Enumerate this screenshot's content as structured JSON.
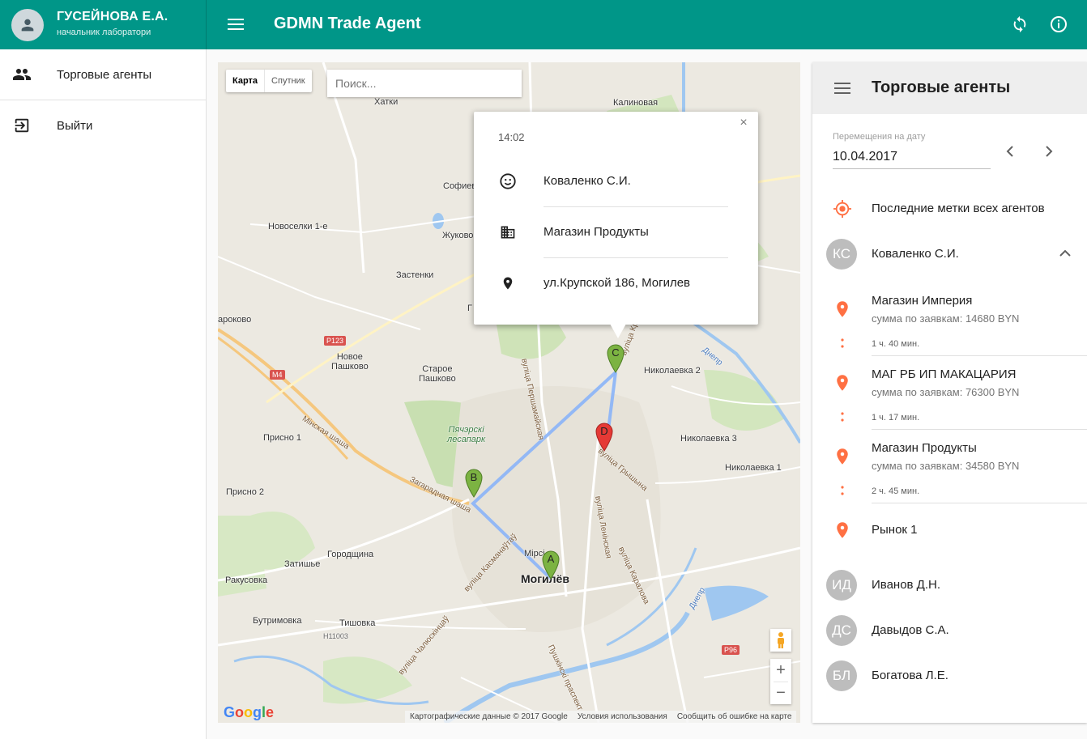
{
  "user": {
    "name": "ГУСЕЙНОВА Е.А.",
    "role": "начальник лаборатори"
  },
  "app": {
    "title": "GDMN Trade Agent"
  },
  "nav": [
    {
      "label": "Торговые агенты",
      "icon": "people-icon"
    },
    {
      "label": "Выйти",
      "icon": "exit-icon"
    }
  ],
  "map": {
    "type_options": [
      "Карта",
      "Спутник"
    ],
    "type_selected": "Карта",
    "search_placeholder": "Поиск...",
    "labels": {
      "hatki": "Хатки",
      "kalinovaya": "Калиновая",
      "sofievka": "Софиев",
      "novoselki": "Новоселки 1-е",
      "zhukovo": "Жуково",
      "zastenki": "Застенки",
      "g": "Г",
      "prokovo": "ароково",
      "novoe_pashkovo": "Новое\nПашково",
      "staroe_pashkovo": "Старое\nПашково",
      "nikolaevka2": "Николаевка 2",
      "nikolaevka3": "Николаевка 3",
      "nikolaevka1": "Николаевка 1",
      "prisno1": "Присно 1",
      "prisno2": "Присно 2",
      "park": "Пячэрскі\nлесапарк",
      "minsk_road": "Мінская шаша",
      "zagorad_road": "Загарадная шаша",
      "zatishe": "Затишье",
      "gorodshchina": "Городщина",
      "rakusovka": "Ракусовка",
      "butrimovka": "Бутримовка",
      "tishovka": "Тишовка",
      "mogilev": "Могилёв",
      "mir": "Мірсі",
      "dnepr1": "Днепр",
      "dnepr2": "Днепр",
      "perashkovskaya": "вуліца Першамайская",
      "kruplskaya": "вуліца Крупскай",
      "gryshyna": "вуліца Грышына",
      "leninskaya": "вуліца Ленінская",
      "karalova": "вуліца Каралова",
      "kasmanauta": "вуліца Касманаўтаў",
      "chalyuskintsau": "вуліца Чалюскінцаў",
      "pushkin": "Пушкінскі праспект",
      "h11003": "H11003"
    },
    "badges": {
      "p123": "P123",
      "m4": "M4",
      "p96": "P96"
    },
    "markers": {
      "a": "A",
      "b": "B",
      "c": "C",
      "d": "D"
    },
    "attribution": {
      "data": "Картографические данные © 2017 Google",
      "terms": "Условия использования",
      "report": "Сообщить об ошибке на карте"
    },
    "google": "Google"
  },
  "infowindow": {
    "time": "14:02",
    "agent": "Коваленко С.И.",
    "place": "Магазин Продукты",
    "address": "ул.Крупской 186, Могилев"
  },
  "panel": {
    "title": "Торговые агенты",
    "date_label": "Перемещения на дату",
    "date_value": "10.04.2017",
    "last_marks": "Последние метки всех агентов",
    "agents": [
      {
        "initials": "КС",
        "name": "Коваленко С.И.",
        "expanded": true
      },
      {
        "initials": "ИД",
        "name": "Иванов Д.Н."
      },
      {
        "initials": "ДС",
        "name": "Давыдов С.А."
      },
      {
        "initials": "БЛ",
        "name": "Богатова Л.Е."
      }
    ],
    "visits": [
      {
        "name": "Магазин Империя",
        "sum": "сумма по заявкам: 14680 BYN",
        "duration": "1 ч. 40 мин."
      },
      {
        "name": "МАГ РБ ИП МАКАЦАРИЯ",
        "sum": "сумма по заявкам: 76300 BYN",
        "duration": "1 ч. 17 мин."
      },
      {
        "name": "Магазин Продукты",
        "sum": "сумма по заявкам: 34580 BYN",
        "duration": "2 ч. 45 мин."
      },
      {
        "name": "Рынок 1"
      }
    ]
  },
  "colors": {
    "primary": "#009688",
    "accent": "#ff7043",
    "marker_green": "#7cb342",
    "marker_red": "#e53935",
    "route": "#8ab4f8"
  }
}
